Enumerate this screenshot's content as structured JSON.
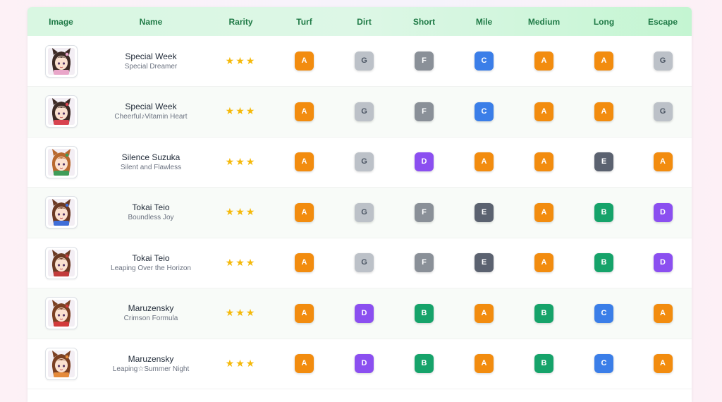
{
  "columns": [
    "Image",
    "Name",
    "Rarity",
    "Turf",
    "Dirt",
    "Short",
    "Mile",
    "Medium",
    "Long",
    "Escape"
  ],
  "grade_colors": {
    "A": "#f28c0f",
    "B": "#16a36a",
    "C": "#3b7ee8",
    "D": "#8b4ff0",
    "E": "#5b6270",
    "F": "#8a9098",
    "G": "#bcc1c8"
  },
  "rows": [
    {
      "name": "Special Week",
      "subtitle": "Special Dreamer",
      "rarity": "★★★",
      "hair": "#3d2a25",
      "accent": "#e9a6c9",
      "aptitudes": [
        "A",
        "G",
        "F",
        "C",
        "A",
        "A",
        "G"
      ]
    },
    {
      "name": "Special Week",
      "subtitle": "Cheerful♪Vitamin Heart",
      "rarity": "★★★",
      "hair": "#3d2a25",
      "accent": "#d8434f",
      "aptitudes": [
        "A",
        "G",
        "F",
        "C",
        "A",
        "A",
        "G"
      ]
    },
    {
      "name": "Silence Suzuka",
      "subtitle": "Silent and Flawless",
      "rarity": "★★★",
      "hair": "#b8682e",
      "accent": "#3f9c58",
      "aptitudes": [
        "A",
        "G",
        "D",
        "A",
        "A",
        "E",
        "A"
      ]
    },
    {
      "name": "Tokai Teio",
      "subtitle": "Boundless Joy",
      "rarity": "★★★",
      "hair": "#6b3a24",
      "accent": "#3f6ed8",
      "aptitudes": [
        "A",
        "G",
        "F",
        "E",
        "A",
        "B",
        "D"
      ]
    },
    {
      "name": "Tokai Teio",
      "subtitle": "Leaping Over the Horizon",
      "rarity": "★★★",
      "hair": "#6b3a24",
      "accent": "#c23b3b",
      "aptitudes": [
        "A",
        "G",
        "F",
        "E",
        "A",
        "B",
        "D"
      ]
    },
    {
      "name": "Maruzensky",
      "subtitle": "Crimson Formula",
      "rarity": "★★★",
      "hair": "#7a3f22",
      "accent": "#d23a3a",
      "aptitudes": [
        "A",
        "D",
        "B",
        "A",
        "B",
        "C",
        "A"
      ]
    },
    {
      "name": "Maruzensky",
      "subtitle": "Leaping☆Summer Night",
      "rarity": "★★★",
      "hair": "#7a3f22",
      "accent": "#e58a3b",
      "aptitudes": [
        "A",
        "D",
        "B",
        "A",
        "B",
        "C",
        "A"
      ]
    }
  ]
}
